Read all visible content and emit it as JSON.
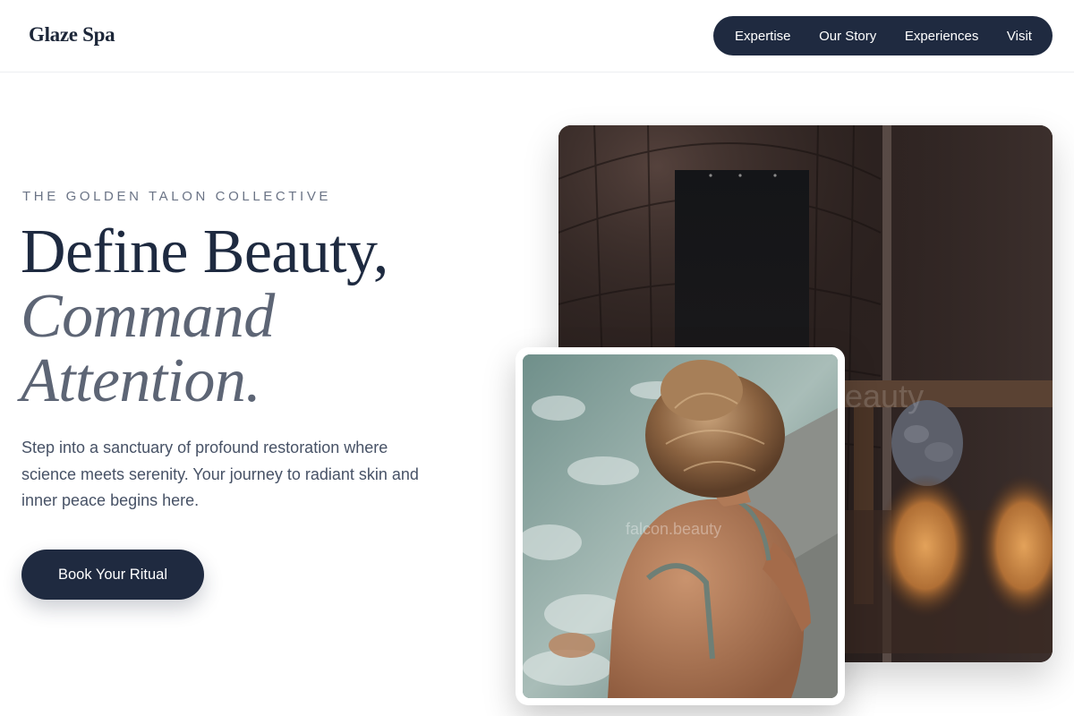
{
  "brand": {
    "name": "Glaze Spa"
  },
  "nav": {
    "items": [
      {
        "label": "Expertise"
      },
      {
        "label": "Our Story"
      },
      {
        "label": "Experiences"
      },
      {
        "label": "Visit"
      }
    ]
  },
  "hero": {
    "eyebrow": "THE GOLDEN TALON COLLECTIVE",
    "headline_line1": "Define Beauty,",
    "headline_line2": "Command",
    "headline_line3": "Attention.",
    "description": "Step into a sanctuary of profound restoration where science meets serenity. Your journey to radiant skin and inner peace begins here.",
    "cta_label": "Book Your Ritual"
  },
  "images": {
    "primary": {
      "subject": "sauna-interior",
      "watermark": "eauty"
    },
    "secondary": {
      "subject": "woman-in-spa-pool",
      "watermark": "falcon.beauty"
    }
  },
  "colors": {
    "navy": "#1f2a40",
    "heading": "#1e2a40",
    "muted_heading": "#5d6575",
    "body_text": "#475266",
    "eyebrow": "#6b7486",
    "background": "#ffffff"
  }
}
